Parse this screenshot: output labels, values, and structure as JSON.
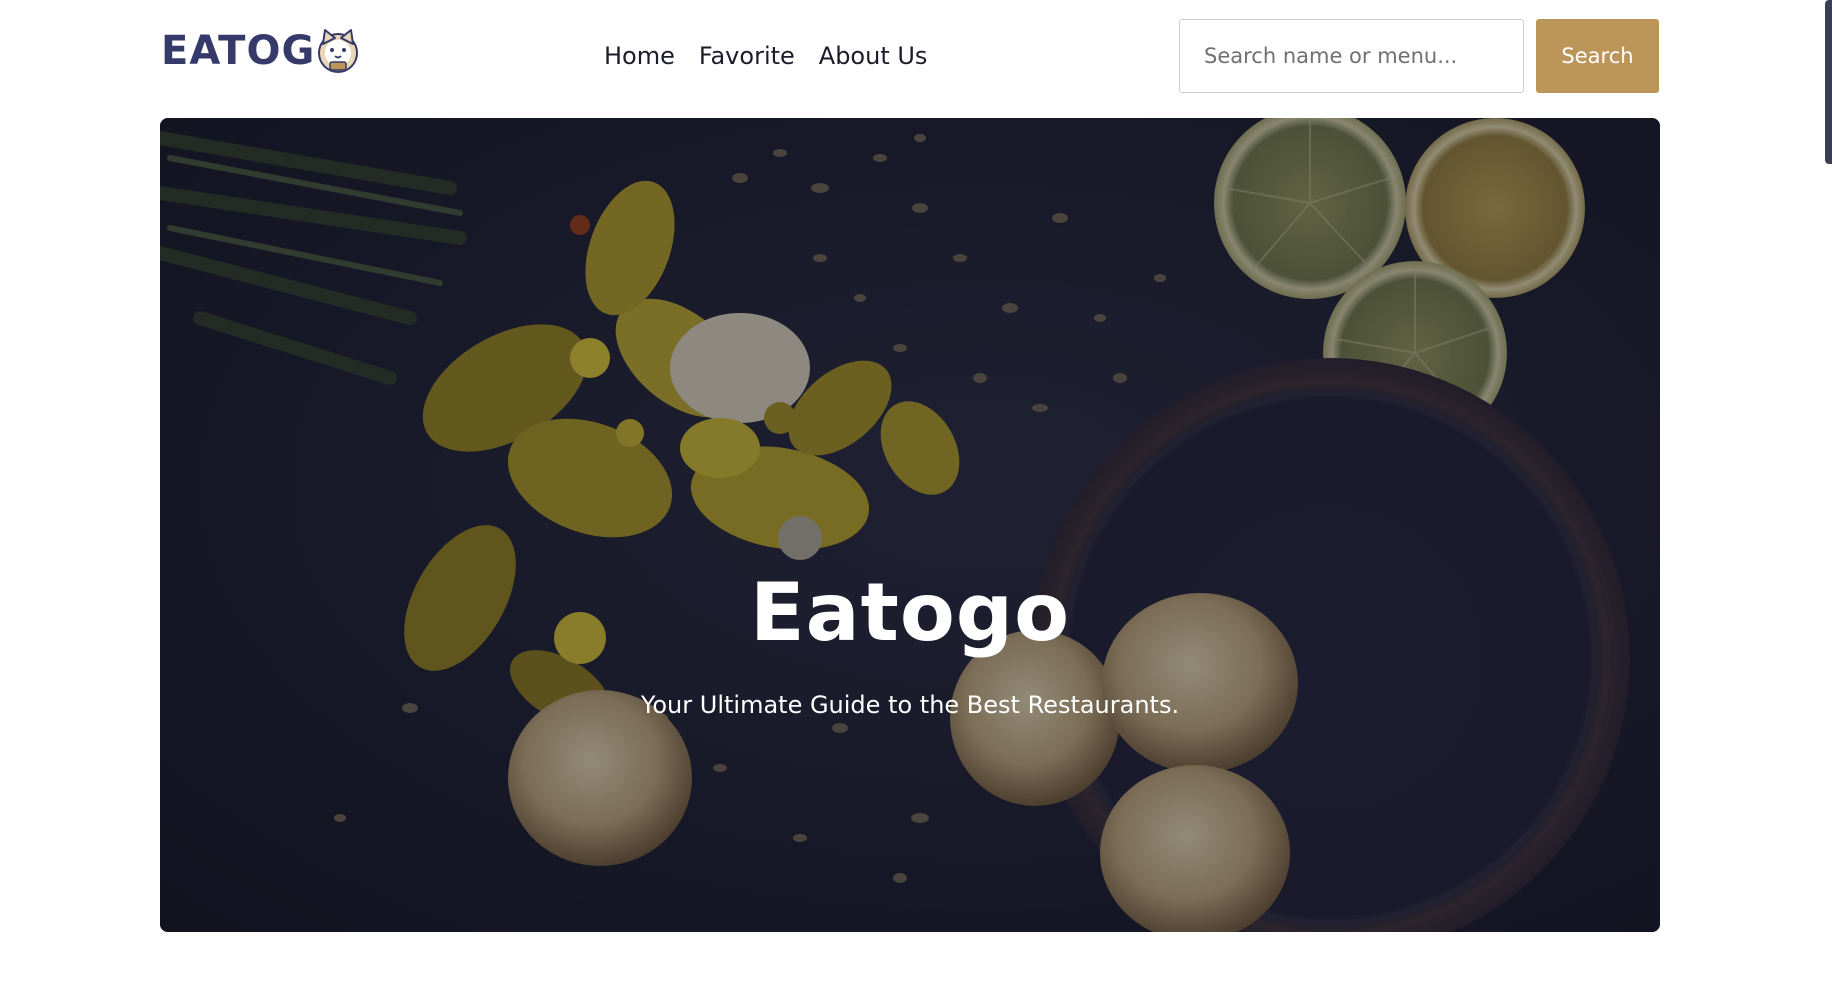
{
  "header": {
    "logo_text": "EATOG",
    "logo_icon": "cat-mascot-icon",
    "nav": [
      {
        "label": "Home"
      },
      {
        "label": "Favorite"
      },
      {
        "label": "About Us"
      }
    ],
    "search": {
      "placeholder": "Search name or menu...",
      "value": "",
      "button_label": "Search"
    }
  },
  "hero": {
    "title": "Eatogo",
    "subtitle": "Your Ultimate Guide to the Best Restaurants."
  },
  "colors": {
    "brand_text": "#363a6b",
    "accent": "#bb9658",
    "hero_background": "#1c1d2e"
  }
}
